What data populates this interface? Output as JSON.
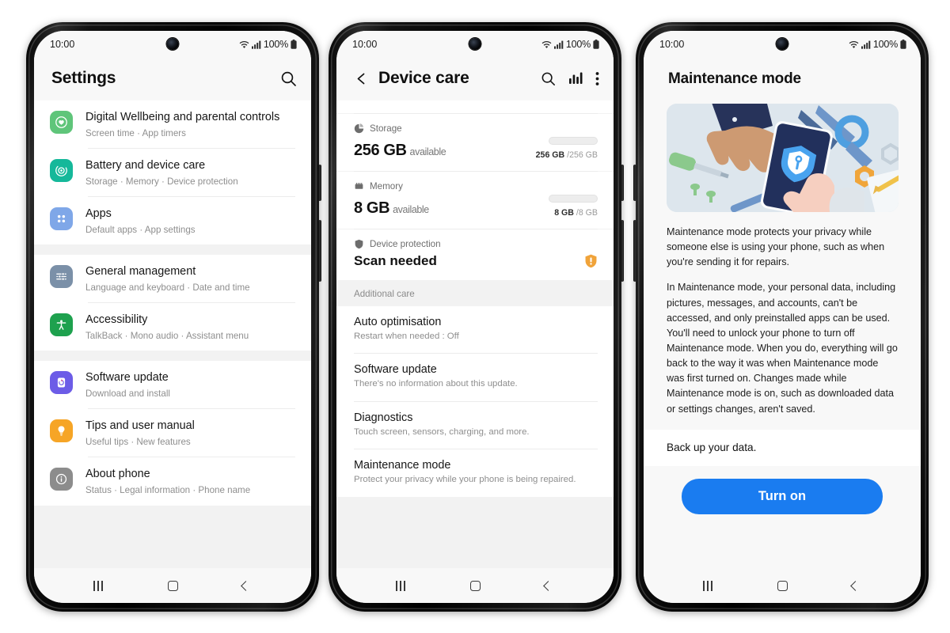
{
  "status_bar": {
    "time": "10:00",
    "battery": "100%",
    "wifi_icon": "wifi-icon",
    "signal_icon": "signal-bars-icon",
    "battery_icon": "battery-full-icon",
    "camera": "front-camera-punch-hole"
  },
  "nav_bar": {
    "recents": "recents-button",
    "home": "home-button",
    "back": "back-button"
  },
  "phone1": {
    "header": {
      "title": "Settings",
      "search_icon": "search-icon"
    },
    "groups": [
      {
        "items": [
          {
            "icon": "digital-wellbeing-icon",
            "color": "#5fc57a",
            "title": "Digital Wellbeing and parental controls",
            "subtitle": "Screen time  ·  App timers"
          },
          {
            "icon": "battery-device-care-icon",
            "color": "#15b89a",
            "title": "Battery and device care",
            "subtitle": "Storage  ·  Memory  ·  Device protection"
          },
          {
            "icon": "apps-grid-icon",
            "color": "#7fa7e8",
            "title": "Apps",
            "subtitle": "Default apps  ·  App settings"
          }
        ]
      },
      {
        "items": [
          {
            "icon": "sliders-icon",
            "color": "#7b90a8",
            "title": "General management",
            "subtitle": "Language and keyboard  ·  Date and time"
          },
          {
            "icon": "accessibility-person-icon",
            "color": "#1ea14e",
            "title": "Accessibility",
            "subtitle": "TalkBack  ·  Mono audio  ·  Assistant menu"
          }
        ]
      },
      {
        "items": [
          {
            "icon": "software-update-icon",
            "color": "#6c5ce7",
            "title": "Software update",
            "subtitle": "Download and install"
          },
          {
            "icon": "lightbulb-tips-icon",
            "color": "#f6a526",
            "title": "Tips and user manual",
            "subtitle": "Useful tips  ·  New features"
          },
          {
            "icon": "info-circle-icon",
            "color": "#8c8c8c",
            "title": "About phone",
            "subtitle": "Status  ·  Legal information  ·  Phone name"
          }
        ]
      }
    ]
  },
  "phone2": {
    "header": {
      "back_icon": "chevron-left-icon",
      "title": "Device care",
      "search_icon": "search-icon",
      "chart_icon": "bar-chart-icon",
      "more_icon": "more-vertical-icon"
    },
    "stats": [
      {
        "icon": "storage-pie-icon",
        "label": "Storage",
        "value": "256",
        "unit": "GB",
        "state": "available",
        "used": "256 GB",
        "total": "/256 GB"
      },
      {
        "icon": "memory-chip-icon",
        "label": "Memory",
        "value": "8",
        "unit": "GB",
        "state": "available",
        "used": "8 GB",
        "total": "/8 GB"
      }
    ],
    "protection": {
      "icon": "shield-icon",
      "label": "Device protection",
      "value": "Scan needed",
      "badge_icon": "shield-warning-icon",
      "badge_color": "#f0a33a"
    },
    "additional_care_header": "Additional care",
    "additional_care": [
      {
        "title": "Auto optimisation",
        "subtitle": "Restart when needed : Off"
      },
      {
        "title": "Software update",
        "subtitle": "There's no information about this update."
      },
      {
        "title": "Diagnostics",
        "subtitle": "Touch screen, sensors, charging, and more."
      },
      {
        "title": "Maintenance mode",
        "subtitle": "Protect your privacy while your phone is being repaired."
      }
    ]
  },
  "phone3": {
    "title": "Maintenance mode",
    "illustration": "maintenance-mode-illustration",
    "paragraphs": [
      "Maintenance mode protects your privacy while someone else is using your phone, such as when you're sending it for repairs.",
      "In Maintenance mode, your personal data, including pictures, messages, and accounts, can't be accessed, and only preinstalled apps can be used. You'll need to unlock your phone to turn off Maintenance mode. When you do, everything will go back to the way it was when Maintenance mode was first turned on. Changes made while Maintenance mode is on, such as downloaded data or settings changes, aren't saved."
    ],
    "backup_label": "Back up your data.",
    "primary_button": "Turn on",
    "primary_button_color": "#1a7cf0"
  }
}
